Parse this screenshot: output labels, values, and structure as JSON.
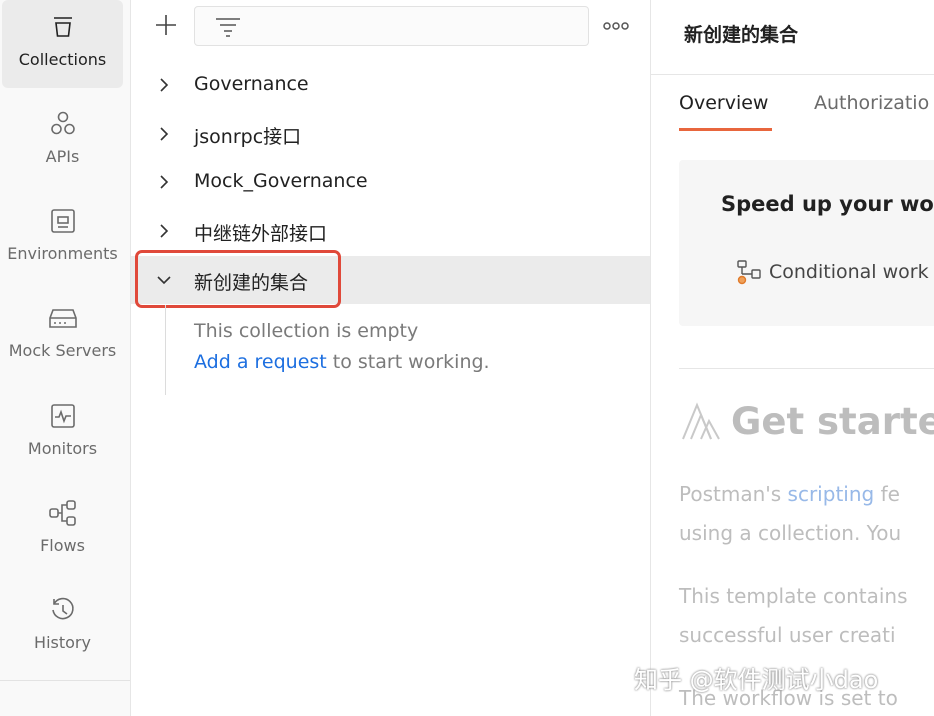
{
  "sidebar": {
    "items": [
      {
        "label": "Collections",
        "icon": "collections-icon",
        "active": true
      },
      {
        "label": "APIs",
        "icon": "apis-icon"
      },
      {
        "label": "Environments",
        "icon": "environments-icon"
      },
      {
        "label": "Mock Servers",
        "icon": "mock-servers-icon"
      },
      {
        "label": "Monitors",
        "icon": "monitors-icon"
      },
      {
        "label": "Flows",
        "icon": "flows-icon"
      },
      {
        "label": "History",
        "icon": "history-icon"
      }
    ]
  },
  "tree": {
    "filter_placeholder": "",
    "collections": [
      {
        "name": "Governance",
        "expanded": false
      },
      {
        "name": "jsonrpc接口",
        "expanded": false
      },
      {
        "name": "Mock_Governance",
        "expanded": false
      },
      {
        "name": "中继链外部接口",
        "expanded": false
      },
      {
        "name": "新创建的集合",
        "expanded": true,
        "selected": true
      }
    ],
    "empty_text": "This collection is empty",
    "empty_link": "Add a request",
    "empty_suffix": " to start working."
  },
  "content": {
    "title": "新创建的集合",
    "tabs": [
      {
        "label": "Overview",
        "active": true
      },
      {
        "label": "Authorizatio"
      }
    ],
    "promo_title": "Speed up your wor",
    "promo_line": "Conditional work",
    "get_started": "Get starte",
    "para1_prefix": "Postman's ",
    "para1_link": "scripting",
    "para1_suffix": " fe",
    "para1_line2": "using a collection. You",
    "para2_line1": "This template contains",
    "para2_line2": "successful user creati",
    "para3_line1": "The workflow is set to"
  },
  "watermark": "知乎 @软件测试小dao",
  "colors": {
    "accent": "#e8663d",
    "highlight_border": "#e0493a",
    "link": "#1d6fe0"
  }
}
